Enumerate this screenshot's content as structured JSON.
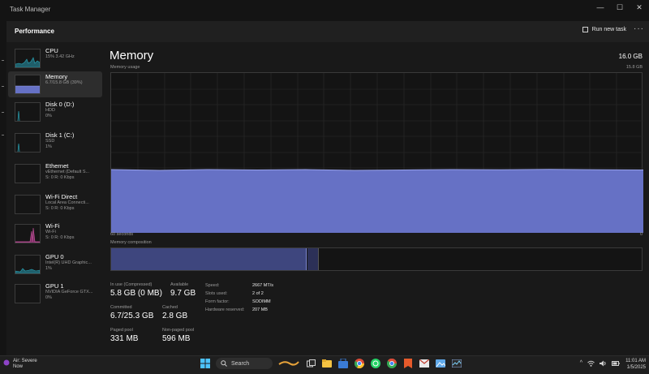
{
  "window": {
    "title": "Task Manager",
    "controls": [
      "—",
      "☐",
      "✕"
    ]
  },
  "header": {
    "title": "Performance",
    "run_new_task": "Run new task",
    "more": "···"
  },
  "sidebar": {
    "items": [
      {
        "name": "CPU",
        "line1": "15% 3.42 GHz",
        "line2": ""
      },
      {
        "name": "Memory",
        "line1": "6.7/15.8 GB (39%)",
        "line2": ""
      },
      {
        "name": "Disk 0 (D:)",
        "line1": "HDD",
        "line2": "0%"
      },
      {
        "name": "Disk 1 (C:)",
        "line1": "SSD",
        "line2": "1%"
      },
      {
        "name": "Ethernet",
        "line1": "vEthernet (Default S...",
        "line2": "S: 0 R: 0 Kbps"
      },
      {
        "name": "Wi-Fi Direct",
        "line1": "Local Area Connecti...",
        "line2": "S: 0 R: 0 Kbps"
      },
      {
        "name": "Wi-Fi",
        "line1": "Wi-Fi",
        "line2": "S: 0 R: 0 Kbps"
      },
      {
        "name": "GPU 0",
        "line1": "Intel(R) UHD Graphic...",
        "line2": "1%"
      },
      {
        "name": "GPU 1",
        "line1": "NVIDIA GeForce GTX...",
        "line2": "0%"
      }
    ]
  },
  "main": {
    "title": "Memory",
    "total": "16.0 GB",
    "usage_label": "Memory usage",
    "max_label": "15.8 GB",
    "axis_left": "60 seconds",
    "axis_right": "0",
    "composition_label": "Memory composition",
    "stats": {
      "in_use_label": "In use (Compressed)",
      "in_use_value": "5.8 GB (0 MB)",
      "available_label": "Available",
      "available_value": "9.7 GB",
      "committed_label": "Committed",
      "committed_value": "6.7/25.3 GB",
      "cached_label": "Cached",
      "cached_value": "2.8 GB",
      "paged_label": "Paged pool",
      "paged_value": "331 MB",
      "nonpaged_label": "Non-paged pool",
      "nonpaged_value": "596 MB"
    },
    "details": [
      {
        "label": "Speed:",
        "value": "2667 MT/s"
      },
      {
        "label": "Slots used:",
        "value": "2 of 2"
      },
      {
        "label": "Form factor:",
        "value": "SODIMM"
      },
      {
        "label": "Hardware reserved:",
        "value": "207 MB"
      }
    ]
  },
  "taskbar": {
    "weather_title": "Air: Severe",
    "weather_sub": "Now",
    "search_label": "Search",
    "time": "11:01 AM",
    "date": "1/5/2025"
  },
  "colors": {
    "memory_fill": "#6671c5",
    "memory_line": "#9aa4ee",
    "cpu": "#2aa6b8",
    "wifi": "#c04f9a"
  }
}
